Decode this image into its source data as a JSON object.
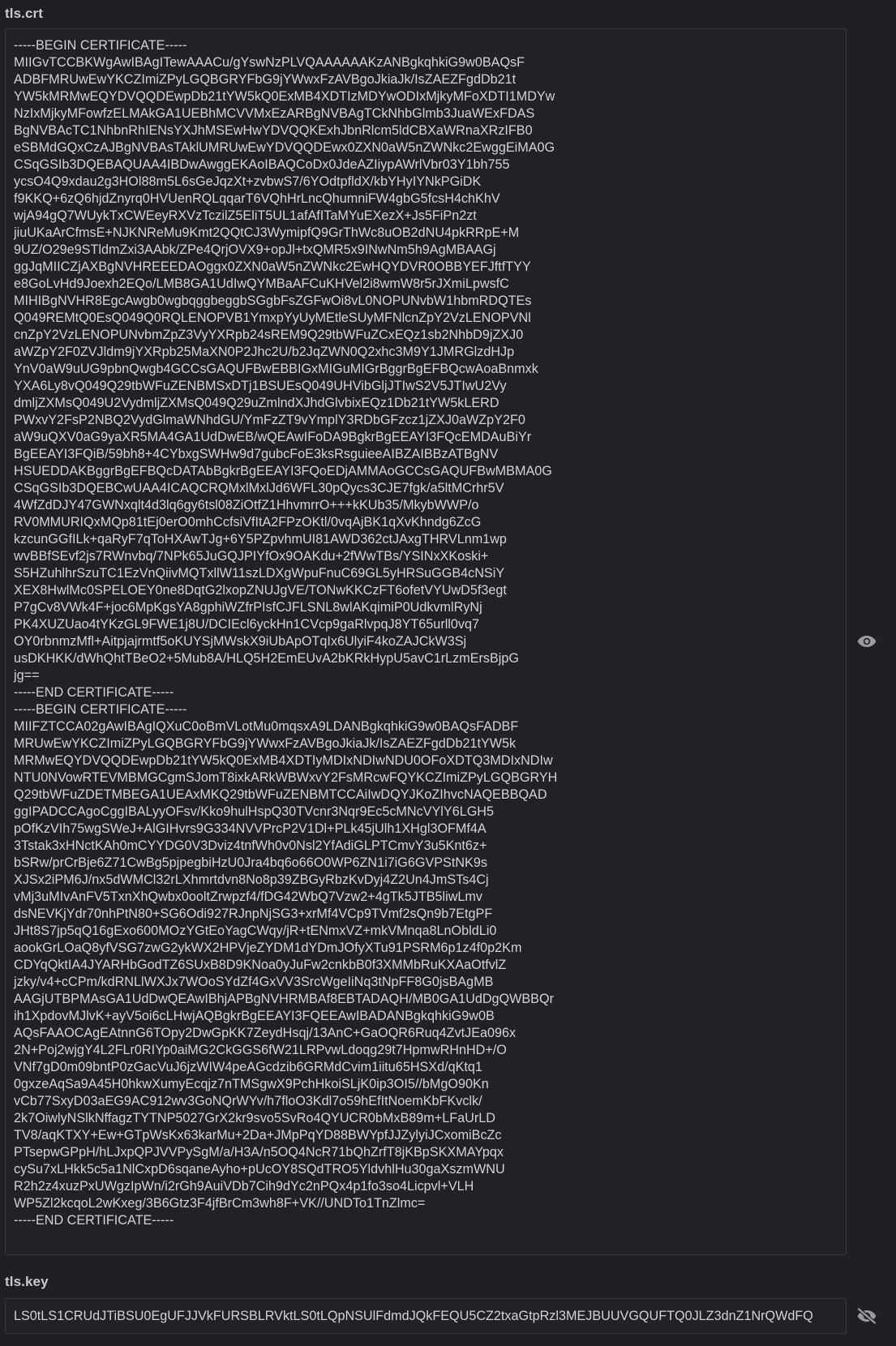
{
  "crt": {
    "label": "tls.crt",
    "visibility_icon": "eye-icon",
    "value": "-----BEGIN CERTIFICATE-----\nMIIGvTCCBKWgAwIBAgITewAAACu/gYswNzPLVQAAAAAAKzANBgkqhkiG9w0BAQsF\nADBFMRUwEwYKCZImiZPyLGQBGRYFbG9jYWwxFzAVBgoJkiaJk/IsZAEZFgdDb21t\nYW5kMRMwEQYDVQQDEwpDb21tYW5kQ0ExMB4XDTIzMDYwODIxMjkyMFoXDTI1MDYw\nNzIxMjkyMFowfzELMAkGA1UEBhMCVVMxEzARBgNVBAgTCkNhbGlmb3JuaWExFDAS\nBgNVBAcTC1NhbnRhIENsYXJhMSEwHwYDVQQKExhJbnRlcm5ldCBXaWRnaXRzIFB0\neSBMdGQxCzAJBgNVBAsTAklUMRUwEwYDVQQDEwx0ZXN0aW5nZWNkc2EwggEiMA0G\nCSqGSIb3DQEBAQUAA4IBDwAwggEKAoIBAQCoDx0JdeAZIiypAWrlVbr03Y1bh755\nycsO4Q9xdau2g3HOl88m5L6sGeJqzXt+zvbwS7/6YOdtpfldX/kbYHyIYNkPGiDK\nf9KKQ+6zQ6hjdZnyrq0HVUenRQLqqarT6VQhHrLncQhumniFW4gbG5fcsH4chKhV\nwjA94gQ7WUykTxCWEeyRXVzTczilZ5EliT5UL1afAfITaMYuEXezX+Js5FiPn2zt\njiuUKaArCfmsE+NJKNReMu9Kmt2QQtCJ3WymipfQ9GrThWc8uOB2dNU4pkRRpE+M\n9UZ/O29e9STldmZxi3AAbk/ZPe4QrjOVX9+opJl+txQMR5x9INwNm5h9AgMBAAGj\nggJqMIICZjAXBgNVHREEEDAOggx0ZXN0aW5nZWNkc2EwHQYDVR0OBBYEFJftfTYY\ne8GoLvHd9Joexh2EQo/LMB8GA1UdIwQYMBaAFCuKHVel2i8wmW8r5rJXmiLpwsfC\nMIHIBgNVHR8EgcAwgb0wgbqggbeggbSGgbFsZGFwOi8vL0NOPUNvbW1hbmRDQTEs\nQ049REMtQ0EsQ049Q0RQLENOPVB1YmxpYyUyMEtleSUyMFNlcnZpY2VzLENOPVNl\ncnZpY2VzLENOPUNvbmZpZ3VyYXRpb24sREM9Q29tbWFuZCxEQz1sb2NhbD9jZXJ0\naWZpY2F0ZVJldm9jYXRpb25MaXN0P2Jhc2U/b2JqZWN0Q2xhc3M9Y1JMRGlzdHJp\nYnV0aW9uUG9pbnQwgb4GCCsGAQUFBwEBBIGxMIGuMIGrBggrBgEFBQcwAoaBnmxk\nYXA6Ly8vQ049Q29tbWFuZENBMSxDTj1BSUEsQ049UHVibGljJTIwS2V5JTIwU2Vy\ndmljZXMsQ049U2VydmljZXMsQ049Q29uZmlndXJhdGlvbixEQz1Db21tYW5kLERD\nPWxvY2FsP2NBQ2VydGlmaWNhdGU/YmFzZT9vYmplY3RDbGFzcz1jZXJ0aWZpY2F0\naW9uQXV0aG9yaXR5MA4GA1UdDwEB/wQEAwIFoDA9BgkrBgEEAYI3FQcEMDAuBiYr\nBgEEAYI3FQiB/59bh8+4CYbxgSWHw9d7gubcFoE3ksRsguieeAIBZAIBBzATBgNV\nHSUEDDAKBggrBgEFBQcDATAbBgkrBgEEAYI3FQoEDjAMMAoGCCsGAQUFBwMBMA0G\nCSqGSIb3DQEBCwUAA4ICAQCRQMxlMxlJd6WFL30pQycs3CJE7fgk/a5ltMCrhr5V\n4WfZdDJY47GWNxqlt4d3lq6gy6tsl08ZiOtfZ1HhvmrrO+++kKUb35/MkybWWP/o\nRV0MMURIQxMQp81tEj0erO0mhCcfsiVfItA2FPzOKtl/0vqAjBK1qXvKhndg6ZcG\nkzcunGGfILk+qaRyF7qToHXAwTJg+6Y5PZpvhmUI81AWD362ctJAxgTHRVLnm1wp\nwvBBfSEvf2js7RWnvbq/7NPk65JuGQJPIYfOx9OAKdu+2fWwTBs/YSINxXKoski+\nS5HZuhlhrSzuTC1EzVnQiivMQTxllW11szLDXgWpuFnuC69GL5yHRSuGGB4cNSiY\nXEX8HwlMc0SPELOEY0ne8DqtG2lxopZNUJgVE/TONwKKCzFT6ofetVYUwD5f3egt\nP7gCv8VWk4F+joc6MpKgsYA8gphiWZfrPIsfCJFLSNL8wlAKqimiP0UdkvmlRyNj\nPK4XUZUao4tYKzGL9FWE1j8U/DCIEcl6yckHn1CVcp9gaRlvpqJ8YT65urll0vq7\nOY0rbnmzMfl+Aitpjajrmtf5oKUYSjMWskX9iUbApOTqIx6UlyiF4koZAJCkW3Sj\nusDKHKK/dWhQhtTBeO2+5Mub8A/HLQ5H2EmEUvA2bKRkHypU5avC1rLzmErsBjpG\njg==\n-----END CERTIFICATE-----\n-----BEGIN CERTIFICATE-----\nMIIFZTCCA02gAwIBAgIQXuC0oBmVLotMu0mqsxA9LDANBgkqhkiG9w0BAQsFADBF\nMRUwEwYKCZImiZPyLGQBGRYFbG9jYWwxFzAVBgoJkiaJk/IsZAEZFgdDb21tYW5k\nMRMwEQYDVQQDEwpDb21tYW5kQ0ExMB4XDTIyMDIxNDIwNDU0OFoXDTQ3MDIxNDIw\nNTU0NVowRTEVMBMGCgmSJomT8ixkARkWBWxvY2FsMRcwFQYKCZImiZPyLGQBGRYH\nQ29tbWFuZDETMBEGA1UEAxMKQ29tbWFuZENBMTCCAiIwDQYJKoZIhvcNAQEBBQAD\nggIPADCCAgoCggIBALyyOFsv/Kko9hulHspQ30TVcnr3Nqr9Ec5cMNcVYlY6LGH5\npOfKzVIh75wgSWeJ+AlGIHvrs9G334NVVPrcP2V1Dl+PLk45jUlh1XHgl3OFMf4A\n3Tstak3xHNctKAh0mCYYDG0V3Dviz4tnfWh0v0Nsl2YfAdiGLPTCmvY3u5Knt6z+\nbSRw/prCrBje6Z71CwBg5pjpegbiHzU0Jra4bq6o66O0WP6ZN1i7iG6GVPStNK9s\nXJSx2iPM6J/nx5dWMCl32rLXhmrtdvn8No8p39ZBGyRbzKvDyj4Z2Un4JmSTs4Cj\nvMj3uMIvAnFV5TxnXhQwbx0ooltZrwpzf4/fDG42WbQ7Vzw2+4gTk5JTB5liwLmv\ndsNEVKjYdr70nhPtN80+SG6Odi927RJnpNjSG3+xrMf4VCp9TVmf2sQn9b7EtgPF\nJHt8S7jp5qQ16gExo600MOzYGtEoYagCWqy/jR+tENmxVZ+mkVMnqa8LnObldLi0\naookGrLOaQ8yfVSG7zwG2ykWX2HPVjeZYDM1dYDmJOfyXTu91PSRM6p1z4f0p2Km\nCDYqQktIA4JYARHbGodTZ6SUxB8D9KNoa0yJuFw2cnkbB0f3XMMbRuKXAaOtfvlZ\njzky/v4+cCPm/kdRNLlWXJx7WOoSYdZf4GxVV3SrcWgeIiNq3tNpFF8G0jsBAgMB\nAAGjUTBPMAsGA1UdDwQEAwIBhjAPBgNVHRMBAf8EBTADAQH/MB0GA1UdDgQWBBQr\nih1XpdovMJlvK+ayV5oi6cLHwjAQBgkrBgEEAYI3FQEEAwIBADANBgkqhkiG9w0B\nAQsFAAOCAgEAtnnG6TOpy2DwGpKK7ZeydHsqj/13AnC+GaOQR6Ruq4ZvtJEa096x\n2N+Poj2wjgY4L2FLr0RIYp0aiMG2CkGGS6fW21LRPvwLdoqg29t7HpmwRHnHD+/O\nVNf7gD0m09bntP0zGacVuJ6jzWIW4peAGcdzib6GRMdCvim1iitu65HSXd/qKtq1\n0gxzeAqSa9A45H0hkwXumyEcqjz7nTMSgwX9PchHkoiSLjK0ip3OI5//bMgO90Kn\nvCb77SxyD03aEG9AC912wv3GoNQrWYv/h7floO3Kdl7o59hEfItNoemKbFKvclk/\n2k7OiwlyNSlkNffagzTYTNP5027GrX2kr9svo5SvRo4QYUCR0bMxB89m+LFaUrLD\nTV8/aqKTXY+Ew+GTpWsKx63karMu+2Da+JMpPqYD88BWYpfJJZylyiJCxomiBcZc\nPTsepwGPpH/hLJxpQPJVVPySgM/a/H3A/n5OQ4NcR71bQhZrfT8jKBpSKXMAYpqx\ncySu7xLHkk5c5a1NlCxpD6sqaneAyho+pUcOY8SQdTRO5YldvhlHu30gaXszmWNU\nR2h2z4xuzPxUWgzIpWn/i2rGh9AuiVDb7Cih9dYc2nPQx4p1fo3so4Licpvl+VLH\nWP5Zl2kcqoL2wKxeg/3B6Gtz3F4jfBrCm3wh8F+VK//UNDTo1TnZlmc=\n-----END CERTIFICATE-----"
  },
  "key": {
    "label": "tls.key",
    "visibility_icon": "eye-off-icon",
    "value": "LS0tLS1CRUdJTiBSU0EgUFJJVkFURSBLRVktLS0tLQpNSUlFdmdJQkFEQU5CZ2txaGtpRzl3MEJBUUVGQUFTQ0JLZ3dnZ1NrQWdFQ"
  },
  "colors": {
    "background": "#1f2024",
    "field_border": "#3a3c41",
    "text": "#d2d3d6",
    "icon": "#9a9ca1"
  }
}
